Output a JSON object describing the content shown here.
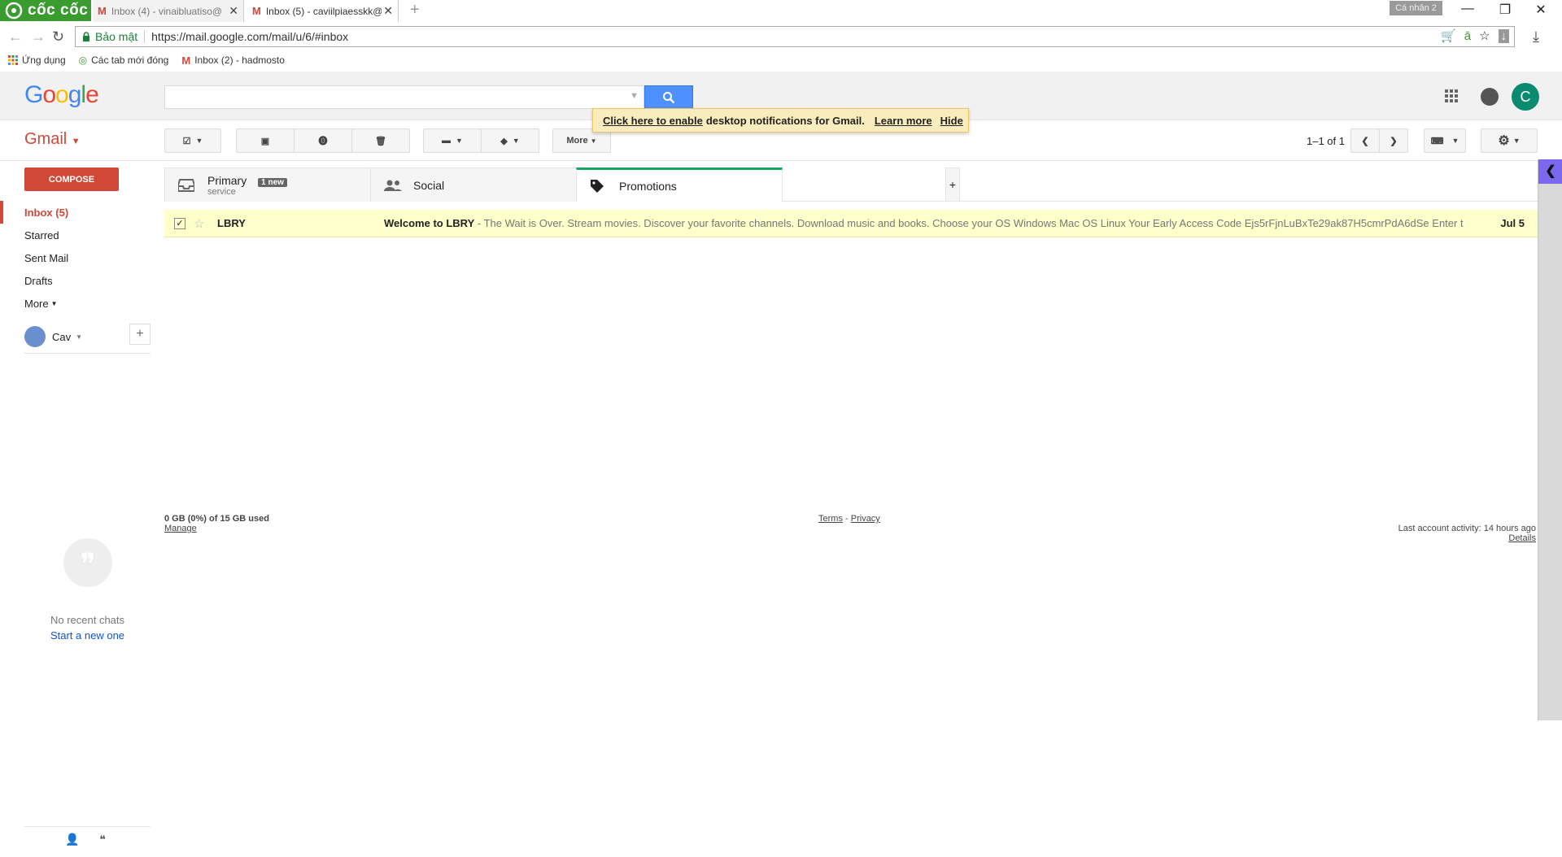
{
  "browser": {
    "brand": "cốc cốc",
    "tabs": [
      {
        "title": "Inbox (4) - vinaibluatiso@"
      },
      {
        "title": "Inbox (5) - caviilpiaesskk@"
      }
    ],
    "profile_badge": "Cá nhân 2",
    "secure_label": "Bảo mật",
    "url": "https://mail.google.com/mail/u/6/#inbox",
    "bookmarks": [
      {
        "label": "Ứng dụng",
        "icon": "apps-grid-icon"
      },
      {
        "label": "Các tab mới đóng",
        "icon": "recent-tabs-icon"
      },
      {
        "label": "Inbox (2) - hadmosto",
        "icon": "gmail-icon"
      }
    ]
  },
  "gmail": {
    "logo": "Google",
    "app_label": "Gmail",
    "avatar_letter": "C",
    "notification": {
      "enable_link": "Click here to enable",
      "text": "desktop notifications for Gmail.",
      "learn_more": "Learn more",
      "hide": "Hide"
    },
    "toolbar": {
      "more_label": "More",
      "pager": "1–1 of 1"
    },
    "compose_label": "COMPOSE",
    "nav": [
      {
        "label": "Inbox (5)",
        "active": true
      },
      {
        "label": "Starred",
        "active": false
      },
      {
        "label": "Sent Mail",
        "active": false
      },
      {
        "label": "Drafts",
        "active": false
      },
      {
        "label": "More",
        "active": false
      }
    ],
    "hangouts": {
      "user": "Cav",
      "no_chats": "No recent chats",
      "start_new": "Start a new one"
    },
    "categories": [
      {
        "label": "Primary",
        "sub": "service",
        "badge": "1 new",
        "icon": "inbox-icon"
      },
      {
        "label": "Social",
        "icon": "people-icon"
      },
      {
        "label": "Promotions",
        "icon": "tag-icon",
        "active": true
      }
    ],
    "messages": [
      {
        "sender": "LBRY",
        "subject": "Welcome to LBRY",
        "snippet": " - The Wait is Over. Stream movies. Discover your favorite channels. Download music and books. Choose your OS Windows Mac OS Linux Your Early Access Code Ejs5rFjnLuBxTe29ak87H5cmrPdA6dSe Enter t",
        "date": "Jul 5",
        "checked": true
      }
    ],
    "footer": {
      "storage": "0 GB (0%) of 15 GB used",
      "manage": "Manage",
      "terms": "Terms",
      "privacy": "Privacy",
      "legal_sep": "-",
      "activity": "Last account activity: 14 hours ago",
      "details": "Details"
    }
  },
  "colors": {
    "gmail_red": "#d14836",
    "search_blue": "#4d90fe",
    "promotions_green": "#16a765",
    "unread_yellow": "#ffffcc"
  }
}
